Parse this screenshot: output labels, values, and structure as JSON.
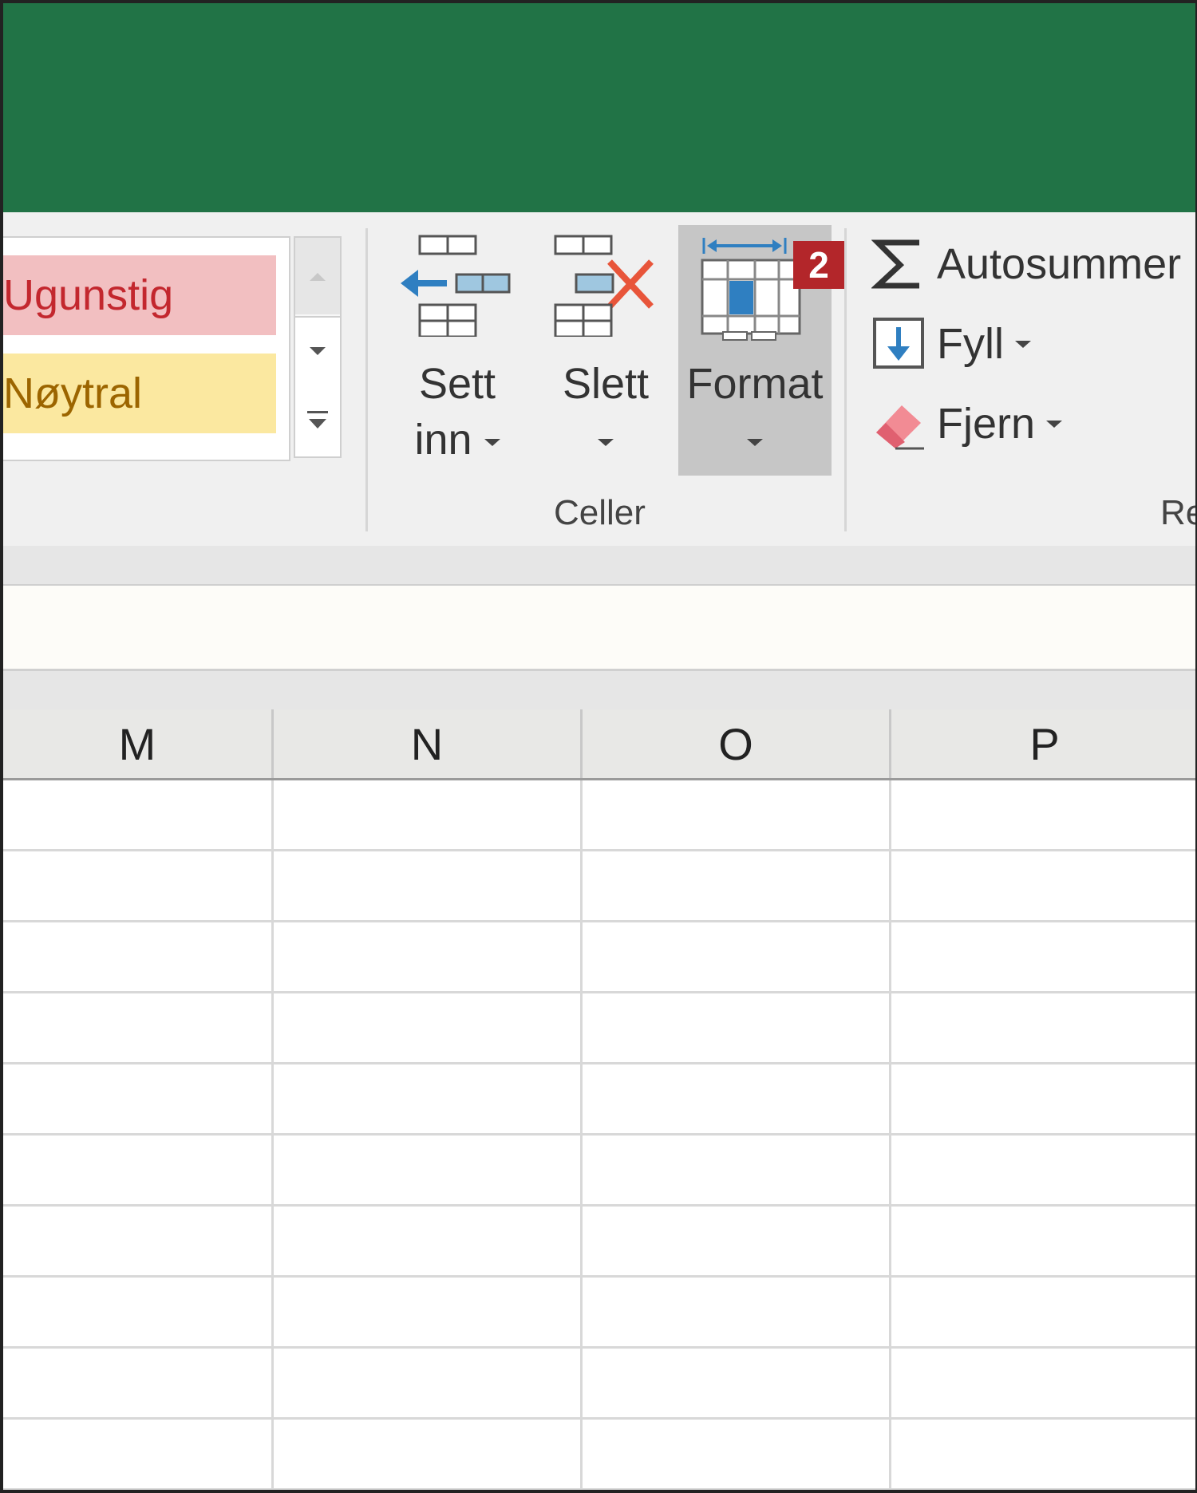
{
  "ribbon": {
    "styles": {
      "bad_label": "Ugunstig",
      "neutral_label": "Nøytral",
      "colors": {
        "bad_bg": "#f2bfc1",
        "bad_text": "#c3272e",
        "neutral_bg": "#fbe8a0",
        "neutral_text": "#9c6500"
      }
    },
    "cells_group": {
      "label": "Celler",
      "insert": {
        "line1": "Sett",
        "line2": "inn"
      },
      "delete": {
        "line1": "Slett"
      },
      "format": {
        "line1": "Format"
      },
      "badge": "2"
    },
    "editing_group": {
      "label_partial": "Re",
      "autosum": "Autosummer",
      "fill": "Fyll",
      "clear": "Fjern"
    }
  },
  "sheet": {
    "columns": [
      "M",
      "N",
      "O",
      "P"
    ],
    "visible_rows": 10
  },
  "colors": {
    "title_bar": "#217346",
    "ribbon_bg": "#f0f0f0",
    "badge": "#b3262a",
    "accent_blue": "#2f7fc1",
    "delete_red": "#e8553a"
  }
}
